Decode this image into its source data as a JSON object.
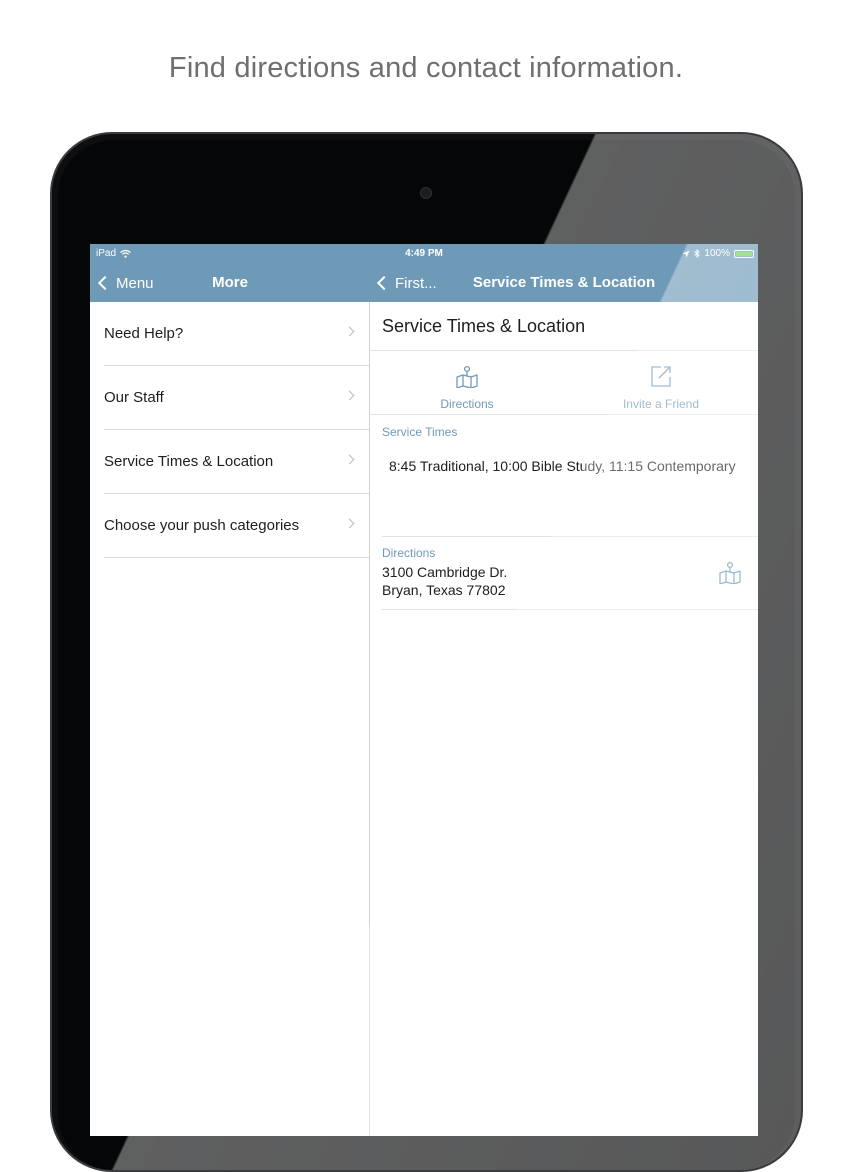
{
  "caption": "Find directions and contact information.",
  "status_bar": {
    "device": "iPad",
    "time": "4:49 PM",
    "battery": "100%"
  },
  "nav": {
    "left_back_label": "Menu",
    "left_title": "More",
    "right_back_label": "First...",
    "right_title": "Service Times & Location"
  },
  "menu_items": [
    {
      "label": "Need Help?"
    },
    {
      "label": "Our Staff"
    },
    {
      "label": "Service Times & Location"
    },
    {
      "label": "Choose your push categories"
    }
  ],
  "detail": {
    "title": "Service Times & Location",
    "actions": {
      "directions_label": "Directions",
      "invite_label": "Invite a Friend"
    },
    "service_times": {
      "label": "Service Times",
      "text": "8:45 Traditional, 10:00 Bible Study, 11:15 Contemporary"
    },
    "directions": {
      "label": "Directions",
      "address_line1": "3100 Cambridge Dr.",
      "address_line2": "Bryan, Texas 77802"
    }
  },
  "colors": {
    "accent": "#6e9ab8",
    "battery": "#6fd36b"
  },
  "icons": [
    "back-chevron-icon",
    "wifi-icon",
    "location-arrow-icon",
    "bluetooth-icon",
    "battery-icon",
    "chevron-right-icon",
    "map-icon",
    "share-icon"
  ]
}
